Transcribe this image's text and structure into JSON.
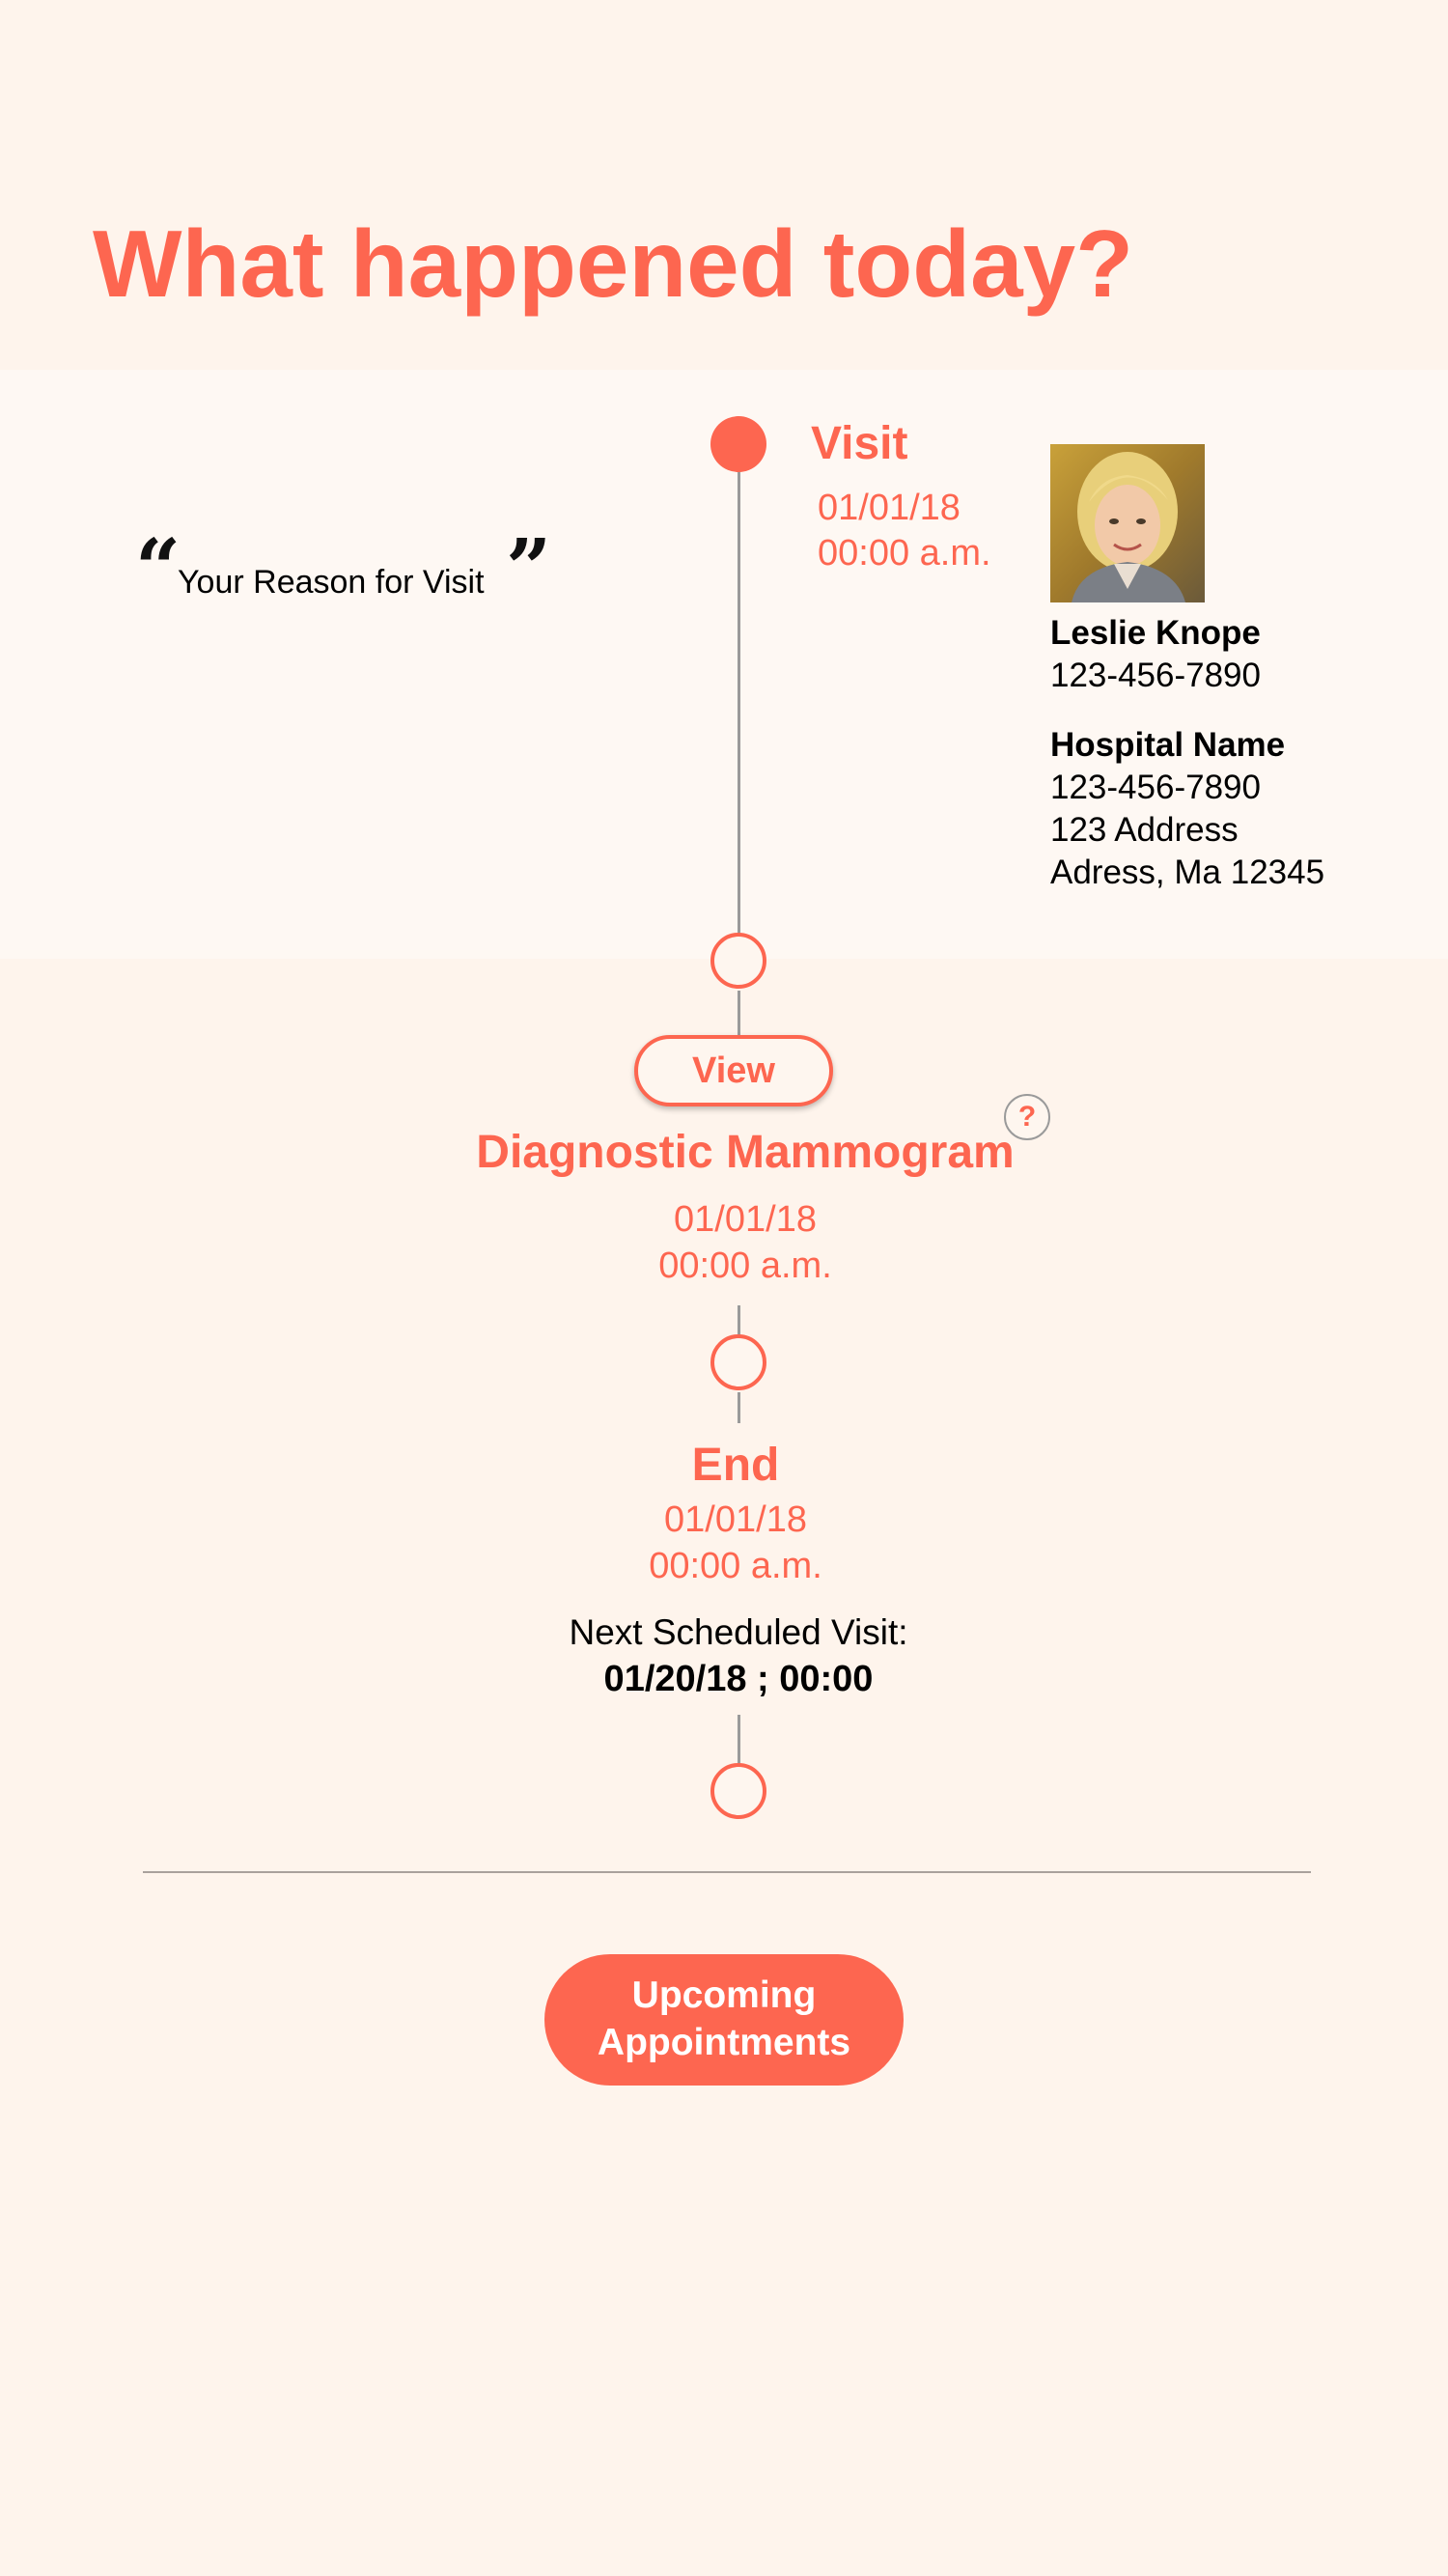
{
  "page_title": "What happened today?",
  "reason": {
    "open_quote": "“",
    "text": "Your Reason for Visit",
    "close_quote": "”"
  },
  "timeline": {
    "visit": {
      "label": "Visit",
      "date": "01/01/18",
      "time": "00:00 a.m."
    },
    "diagnostic": {
      "view_label": "View",
      "help_icon_glyph": "?",
      "label": "Diagnostic Mammogram",
      "date": "01/01/18",
      "time": "00:00 a.m."
    },
    "end": {
      "label": "End",
      "date": "01/01/18",
      "time": "00:00 a.m.",
      "next_visit_label": "Next Scheduled Visit:",
      "next_visit_value": "01/20/18 ; 00:00"
    }
  },
  "doctor": {
    "name": "Leslie Knope",
    "phone": "123-456-7890"
  },
  "hospital": {
    "name": "Hospital Name",
    "phone": "123-456-7890",
    "address_line1": "123 Address",
    "address_line2": "Adress, Ma 12345"
  },
  "upcoming_button": {
    "line1": "Upcoming",
    "line2": "Appointments"
  },
  "colors": {
    "accent": "#fd6650",
    "background": "#fef4ec",
    "band": "#fef8f3",
    "timeline_line": "#9a9a9a"
  },
  "icons": [
    "help-icon",
    "quote-open-icon",
    "quote-close-icon"
  ]
}
